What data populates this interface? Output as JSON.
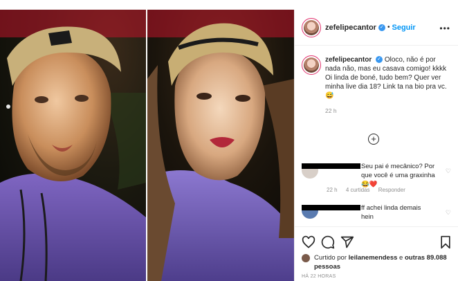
{
  "post": {
    "username": "zefelipecantor",
    "separator": "•",
    "follow_label": "Seguir",
    "more_label": "•••"
  },
  "caption": {
    "username": "zefelipecantor",
    "text": "Oloco, não é por nada não, mas eu casava comigo! kkkk Oi linda de boné, tudo bem? Quer ver minha live dia 18? Link ta na bio pra vc. 😅",
    "time": "22 h"
  },
  "comments": [
    {
      "text": "Seu pai é mecânico? Por que você é uma graxinha😂❤️",
      "time": "22 h",
      "likes": "4 curtidas",
      "reply_label": "Responder"
    },
    {
      "text": "ff achei linda demais hein"
    }
  ],
  "likes": {
    "prefix": "Curtido por",
    "user": "leilanemendess",
    "middle": "e",
    "others": "outras 89.088 pessoas"
  },
  "time_ago": "HÁ 22 HORAS",
  "icons": [
    "verified-icon",
    "more-options-icon",
    "load-more-icon",
    "heart-icon",
    "comment-icon",
    "share-icon",
    "bookmark-icon"
  ],
  "colors": {
    "accent": "#0095f6",
    "verified": "#3897f0",
    "heart": "#ed4956",
    "muted": "#8e8e8e"
  }
}
